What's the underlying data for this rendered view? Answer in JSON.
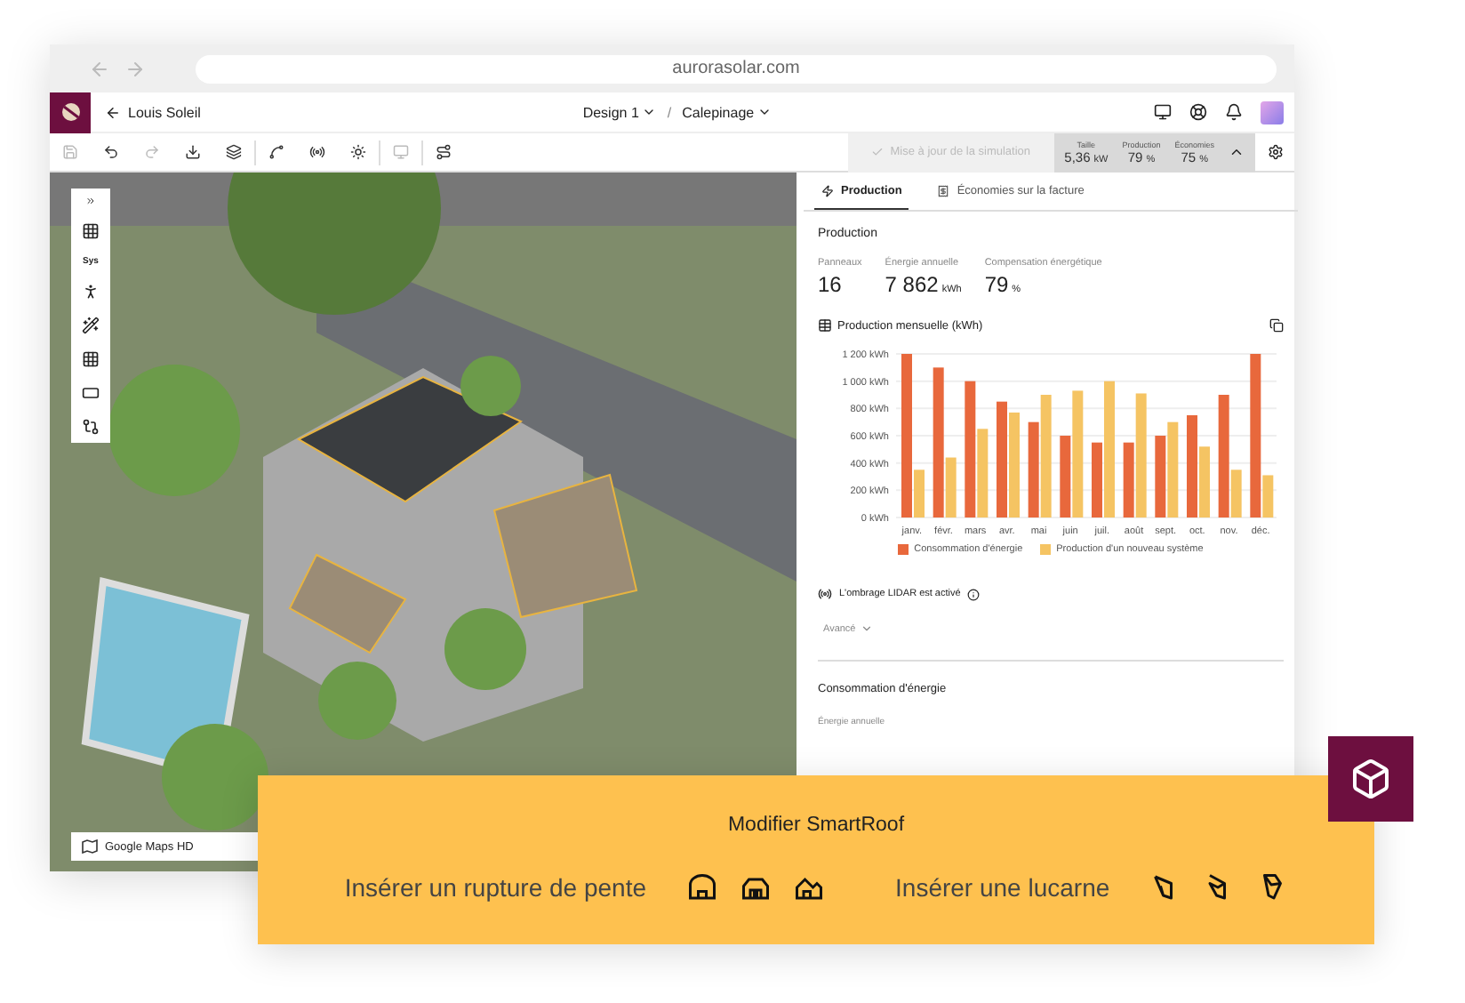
{
  "browser": {
    "url": "aurorasolar.com"
  },
  "header": {
    "project": "Louis Soleil",
    "breadcrumbs": [
      "Design 1",
      "Calepinage"
    ],
    "separator": "/"
  },
  "toolbar": {
    "update_button": {
      "label": "Mise à jour de la simulation",
      "disabled": true
    },
    "stats": [
      {
        "label": "Taille",
        "value": "5,36",
        "unit": "kW"
      },
      {
        "label": "Production",
        "value": "79",
        "unit": "%"
      },
      {
        "label": "Économies",
        "value": "75",
        "unit": "%"
      }
    ]
  },
  "side_tools": {
    "system_label": "Sys"
  },
  "map": {
    "layer_label": "Google Maps HD"
  },
  "panel": {
    "tabs": [
      {
        "label": "Production",
        "selected": true
      },
      {
        "label": "Économies sur la facture",
        "selected": false
      }
    ],
    "section_title": "Production",
    "metrics": [
      {
        "label": "Panneaux",
        "value": "16"
      },
      {
        "label": "Énergie annuelle",
        "value": "7 862",
        "unit": "kWh"
      },
      {
        "label": "Compensation énergétique",
        "value": "79",
        "unit": "%"
      }
    ],
    "chart_title": "Production mensuelle (kWh)",
    "chart_data": {
      "type": "bar",
      "categories": [
        "janv.",
        "févr.",
        "mars",
        "avr.",
        "mai",
        "juin",
        "juil.",
        "août",
        "sept.",
        "oct.",
        "nov.",
        "déc."
      ],
      "series": [
        {
          "name": "Consommation d'énergie",
          "color": "#e8683c",
          "values": [
            1200,
            1100,
            1000,
            850,
            700,
            600,
            550,
            550,
            600,
            750,
            900,
            1200
          ]
        },
        {
          "name": "Production d'un nouveau système",
          "color": "#f5c463",
          "values": [
            350,
            440,
            650,
            770,
            900,
            930,
            1000,
            910,
            700,
            520,
            350,
            310
          ]
        }
      ],
      "ylim": [
        0,
        1200
      ],
      "grid": true,
      "yticks": [
        {
          "value": 0,
          "label": "0 kWh"
        },
        {
          "value": 200,
          "label": "200 kWh"
        },
        {
          "value": 400,
          "label": "400 kWh"
        },
        {
          "value": 600,
          "label": "600 kWh"
        },
        {
          "value": 800,
          "label": "800 kWh"
        },
        {
          "value": 1000,
          "label": "1 000 kWh"
        },
        {
          "value": 1200,
          "label": "1 200 kWh"
        }
      ]
    },
    "lidar": "L'ombrage LIDAR est activé",
    "advanced": "Avancé",
    "consumption_title": "Consommation d'énergie",
    "consumption_label": "Énergie annuelle"
  },
  "smartroof": {
    "title": "Modifier SmartRoof",
    "groups": [
      {
        "label": "Insérer un rupture de pente",
        "kind": "break"
      },
      {
        "label": "Insérer une lucarne",
        "kind": "dormer"
      }
    ]
  }
}
